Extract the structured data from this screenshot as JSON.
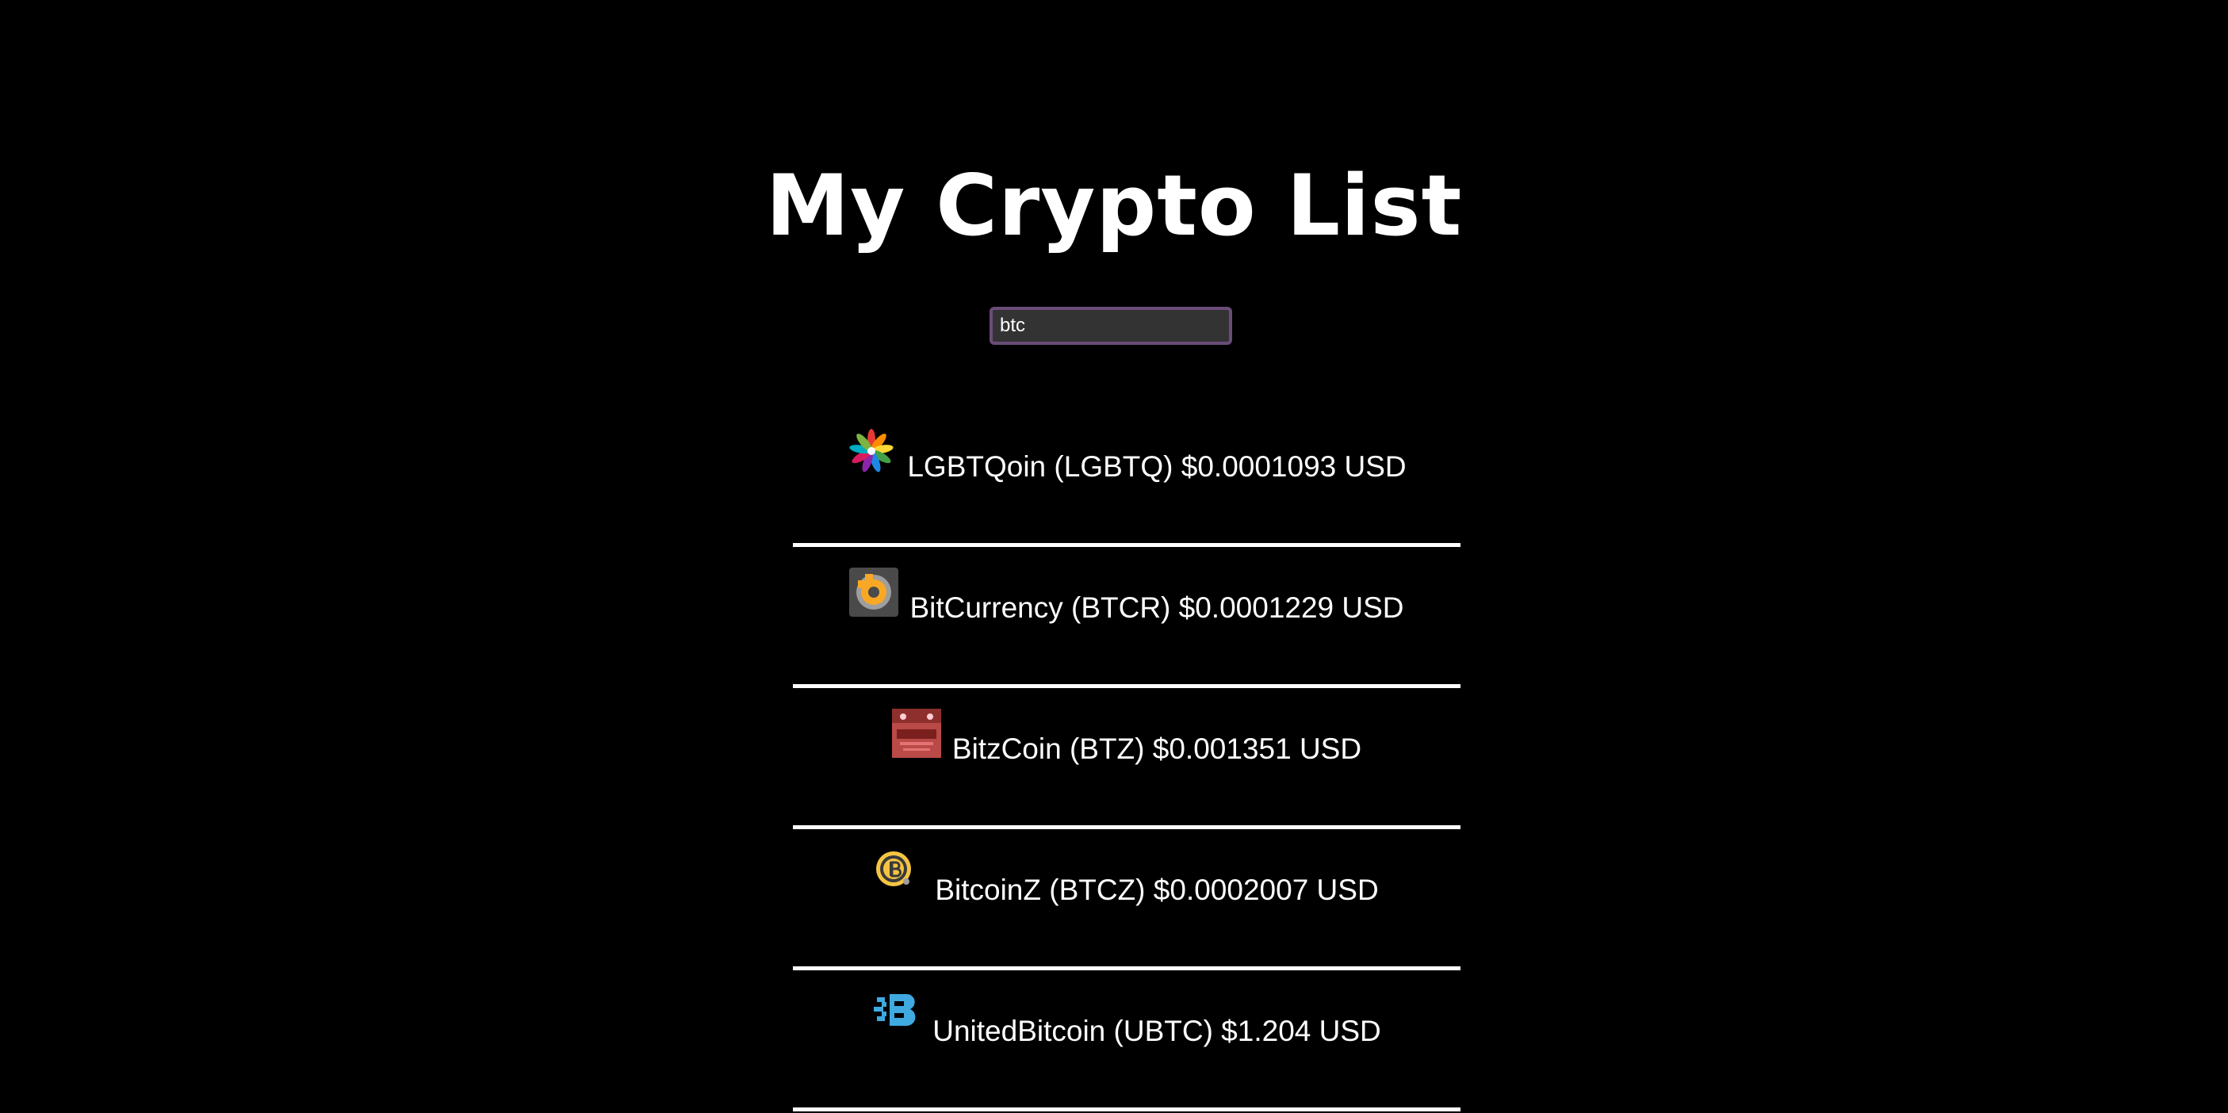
{
  "header": {
    "title": "My Crypto List"
  },
  "search": {
    "value": "btc"
  },
  "coins": [
    {
      "name": "LGBTQoin",
      "symbol": "LGBTQ",
      "label": "LGBTQoin (LGBTQ) $0.0001093 USD",
      "icon": "lgbtq-flower-logo-icon"
    },
    {
      "name": "BitCurrency",
      "symbol": "BTCR",
      "label": "BitCurrency (BTCR) $0.0001229 USD",
      "icon": "bitcurrency-logo-icon"
    },
    {
      "name": "BitzCoin",
      "symbol": "BTZ",
      "label": "BitzCoin (BTZ) $0.001351 USD",
      "icon": "bitzcoin-logo-icon"
    },
    {
      "name": "BitcoinZ",
      "symbol": "BTCZ",
      "label": "BitcoinZ (BTCZ) $0.0002007 USD",
      "icon": "bitcoinz-logo-icon"
    },
    {
      "name": "UnitedBitcoin",
      "symbol": "UBTC",
      "label": "UnitedBitcoin (UBTC) $1.204 USD",
      "icon": "unitedbitcoin-logo-icon"
    }
  ],
  "colors": {
    "background": "#000000",
    "text": "#ffffff",
    "search_border": "#6a4c78",
    "search_background": "#333333",
    "divider": "#ffffff"
  }
}
